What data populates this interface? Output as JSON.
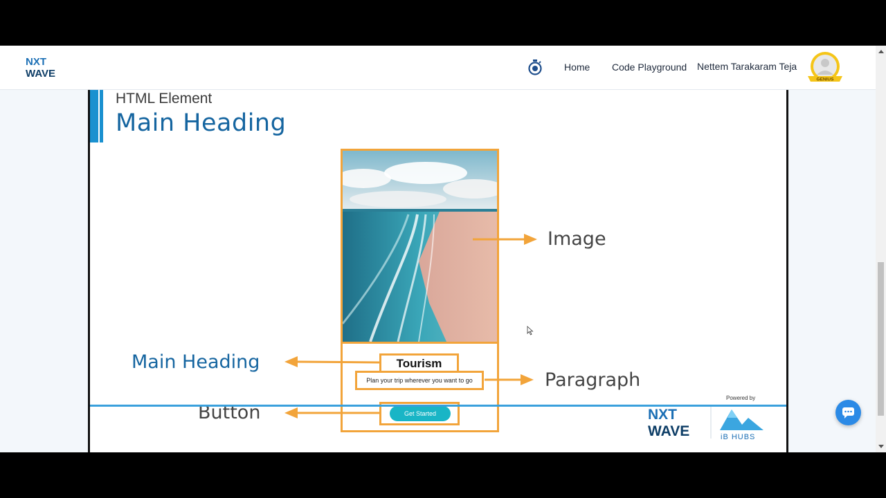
{
  "navbar": {
    "logo_line1": "NXT",
    "logo_line2": "WAVE",
    "links": [
      "Home",
      "Code Playground"
    ],
    "user_name": "Nettem Tarakaram Teja",
    "avatar_badge": "GENIUS"
  },
  "slide": {
    "subtitle": "HTML Element",
    "title": "Main Heading",
    "mock": {
      "heading": "Tourism",
      "paragraph": "Plan your trip wherever you want to go",
      "button": "Get Started"
    },
    "callouts": {
      "image": "Image",
      "paragraph": "Paragraph",
      "main_heading": "Main Heading",
      "button": "Button"
    },
    "branding": {
      "powered_by": "Powered by",
      "logo_line1": "NXT",
      "logo_line2": "WAVE",
      "partner": "iB HUBS"
    }
  },
  "colors": {
    "accent_blue": "#1565a0",
    "highlight_orange": "#f2a43a",
    "button_teal": "#19b5c6",
    "chat_blue": "#2b8ae6"
  }
}
